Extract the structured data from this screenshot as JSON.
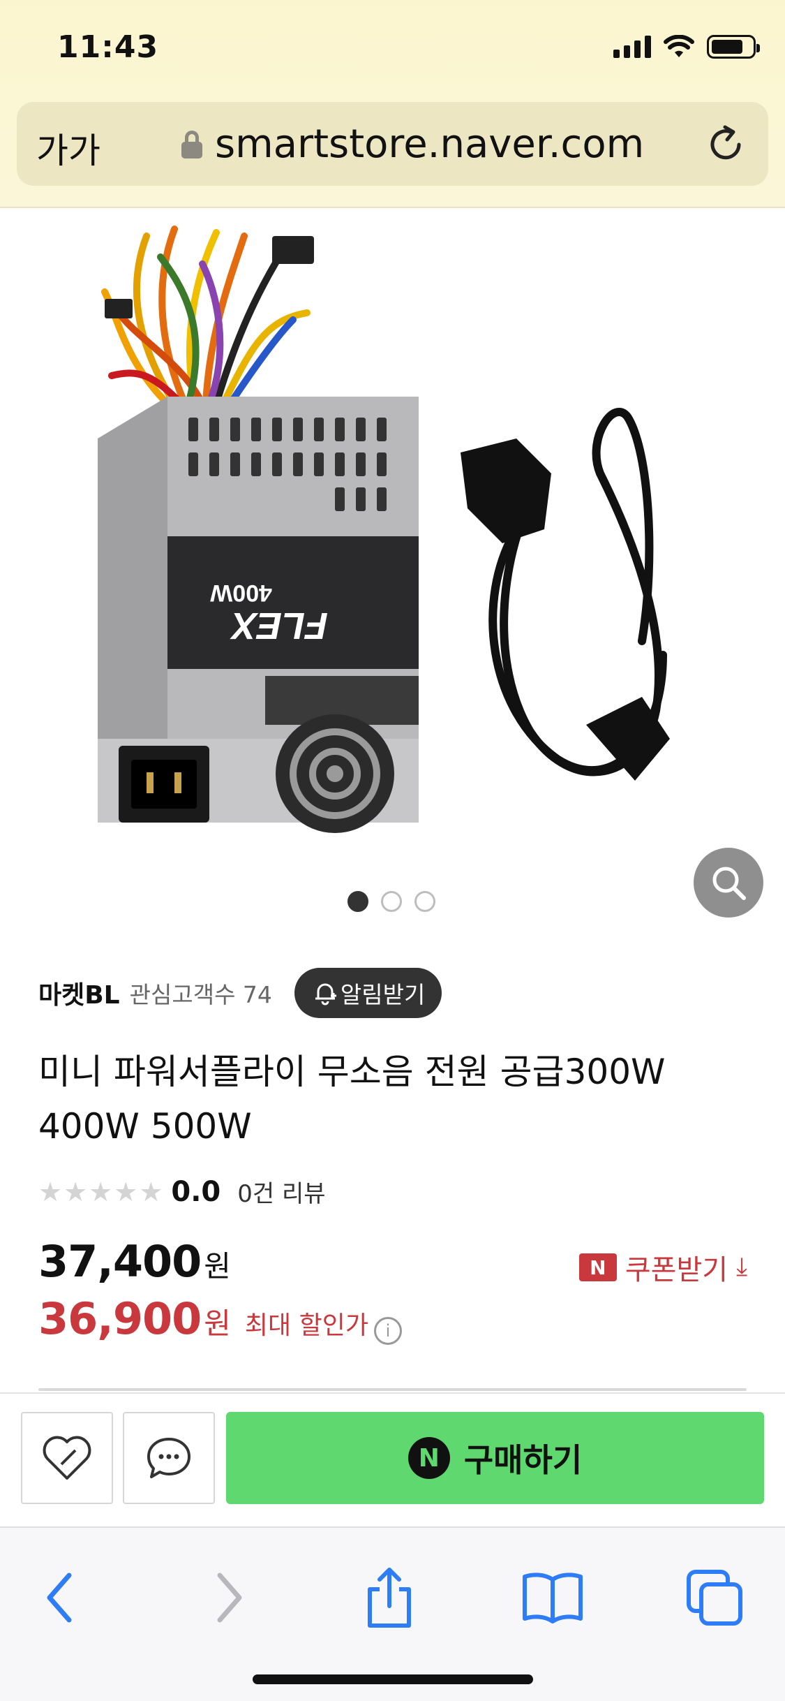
{
  "status_bar": {
    "time": "11:43"
  },
  "browser": {
    "text_size_button": "가가",
    "url": "smartstore.naver.com"
  },
  "product": {
    "image_label_brand": "FLEX",
    "image_label_watt": "400W",
    "image_count": 3,
    "active_image_index": 0,
    "store": {
      "name": "마켓BL",
      "followers_text": "관심고객수 74",
      "alarm_button": "알림받기"
    },
    "title": "미니 파워서플라이 무소음 전원 공급300W 400W 500W",
    "rating": {
      "stars_filled": 0,
      "stars_total": 5,
      "score": "0.0",
      "review_text": "0건 리뷰"
    },
    "price": {
      "original": "37,400",
      "original_unit": "원",
      "sale": "36,900",
      "sale_unit": "원",
      "sale_label": "최대 할인가"
    },
    "coupon": {
      "badge": "N",
      "label": "쿠폰받기",
      "download_symbol": "⤓"
    }
  },
  "purchase_bar": {
    "npay_badge": "N",
    "buy_label": "구매하기"
  },
  "colors": {
    "browser_chrome": "#fbf5cf",
    "url_bar": "#ece6c2",
    "sale_red": "#c8383c",
    "buy_green": "#5fd86f",
    "ios_blue": "#2f7df6"
  },
  "icons": {
    "lock": "lock-icon",
    "reload": "reload-icon",
    "zoom": "search-icon",
    "bell": "bell-plus-icon",
    "heart": "heart-icon",
    "chat": "chat-bubble-icon",
    "back": "chevron-left-icon",
    "forward": "chevron-right-icon",
    "share": "share-icon",
    "bookmarks": "book-icon",
    "tabs": "tabs-icon"
  }
}
